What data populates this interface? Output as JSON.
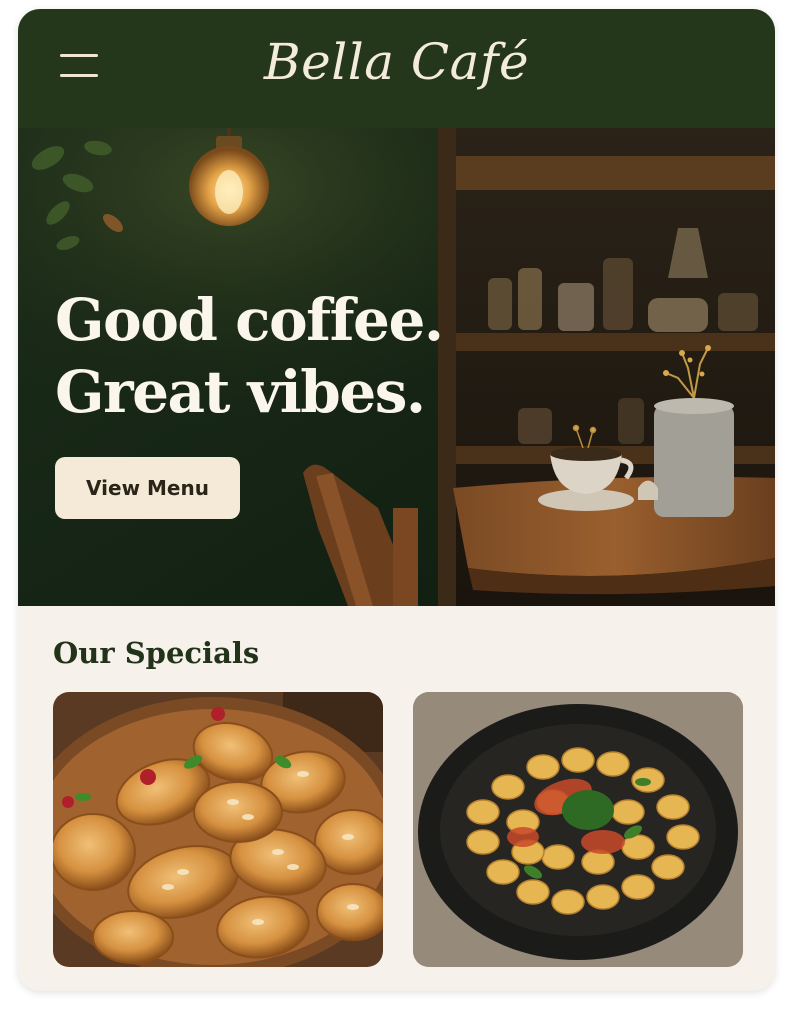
{
  "header": {
    "brand": "Bella Café",
    "menu_icon": "hamburger-menu-icon"
  },
  "hero": {
    "title_line1": "Good coffee.",
    "title_line2": "Great vibes.",
    "cta_label": "View Menu"
  },
  "specials": {
    "title": "Our Specials",
    "items": [
      {
        "image": "croissant-platter-photo"
      },
      {
        "image": "gnocchi-bowl-photo"
      }
    ]
  },
  "colors": {
    "header_bg": "#25371a",
    "card_bg": "#f6f1ea",
    "button_bg": "#f5ead7",
    "heading_green": "#223319"
  }
}
